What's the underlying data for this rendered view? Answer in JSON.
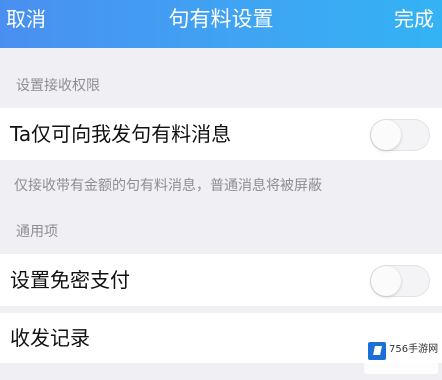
{
  "nav": {
    "left": "取消",
    "title": "句有料设置",
    "right": "完成"
  },
  "sections": {
    "receive_header": "设置接收权限",
    "general_header": "通用项"
  },
  "rows": {
    "only_receive_label": "Ta仅可向我发句有料消息",
    "only_receive_on": false,
    "only_receive_desc": "仅接收带有金额的句有料消息，普通消息将被屏蔽",
    "secret_pay_label": "设置免密支付",
    "secret_pay_on": false,
    "history_label": "收发记录"
  },
  "watermark": {
    "text": "756手游网"
  },
  "colors": {
    "nav_gradient_start": "#4a8ff0",
    "nav_gradient_end": "#33b3f4",
    "background": "#efeff4"
  }
}
